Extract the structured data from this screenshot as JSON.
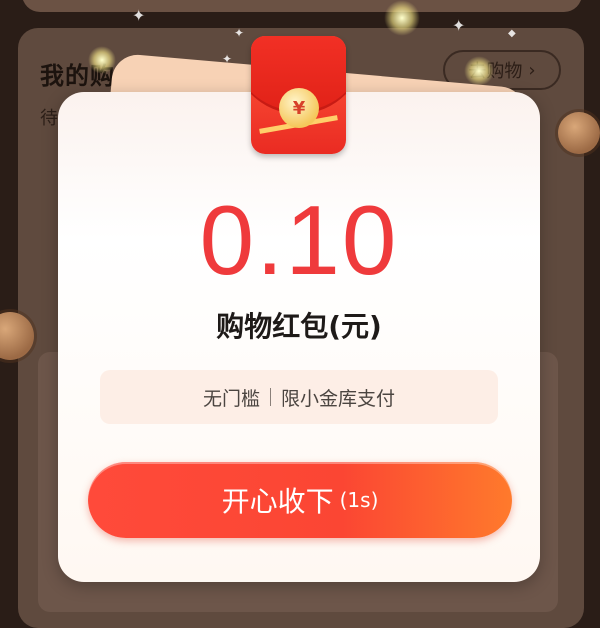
{
  "background": {
    "section_title": "我的购物红包",
    "subtitle": "待",
    "go_shopping_label": "去购物",
    "go_shopping_chevron": "›"
  },
  "modal": {
    "amount": "0.10",
    "amount_label": "购物红包(元)",
    "note_left": "无门槛",
    "note_right": "限小金库支付",
    "cta_label": "开心收下",
    "cta_countdown": "(1s)",
    "envelope_symbol": "¥"
  },
  "colors": {
    "amount": "#ef3a3c",
    "cta_gradient_start": "#ff4a3a",
    "cta_gradient_end": "#ff7a2c",
    "envelope": "#ea2b22"
  },
  "icons": [
    "red-envelope-icon",
    "chevron-right-icon",
    "sparkle-icon",
    "coin-icon"
  ]
}
